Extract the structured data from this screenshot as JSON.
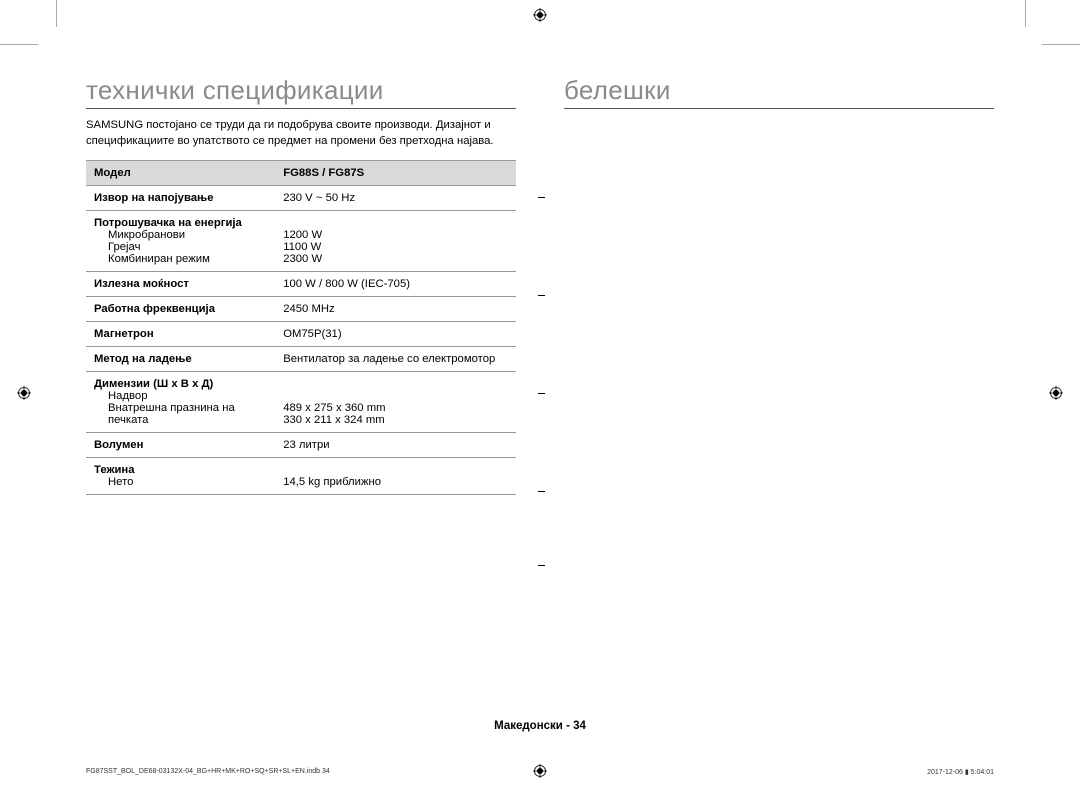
{
  "left": {
    "heading": "технички спецификации",
    "intro": "SAMSUNG постојано се труди да ги подобрува своите производи. Дизајнот и спецификациите во упатството се предмет на промени без претходна најава."
  },
  "right": {
    "heading": "белешки"
  },
  "table": {
    "h1": "Модел",
    "h2": "FG88S / FG87S",
    "r_power_label": "Извор на напојување",
    "r_power_val": "230 V ~ 50 Hz",
    "r_cons_label": "Потрошувачка на енергија",
    "r_cons_sub1": "Микробранови",
    "r_cons_sub2": "Грејач",
    "r_cons_sub3": "Комбиниран режим",
    "r_cons_v1": "1200 W",
    "r_cons_v2": "1100 W",
    "r_cons_v3": "2300 W",
    "r_out_label": "Излезна моќност",
    "r_out_val": "100 W / 800 W (IEC-705)",
    "r_freq_label": "Работна фреквенција",
    "r_freq_val": "2450 MHz",
    "r_mag_label": "Магнетрон",
    "r_mag_val": "OM75P(31)",
    "r_cool_label": "Метод на ладење",
    "r_cool_val": "Вентилатор за ладење со електромотор",
    "r_dim_label": "Димензии (Ш x В x Д)",
    "r_dim_sub1": "Надвор",
    "r_dim_sub2": "Внатрешна празнина на печката",
    "r_dim_v1": "489 x 275 x 360 mm",
    "r_dim_v2": "330 x 211 x 324 mm",
    "r_vol_label": "Волумен",
    "r_vol_val": "23 литри",
    "r_wt_label": "Тежина",
    "r_wt_sub1": "Нето",
    "r_wt_v1": "14,5 kg приближно"
  },
  "footer": {
    "page": "Македонски - 34",
    "left": "FG87SST_BOL_DE68-03132X-04_BG+HR+MK+RO+SQ+SR+SL+EN.indb   34",
    "right": "2017-12-06   ▮ 5:04:01"
  }
}
